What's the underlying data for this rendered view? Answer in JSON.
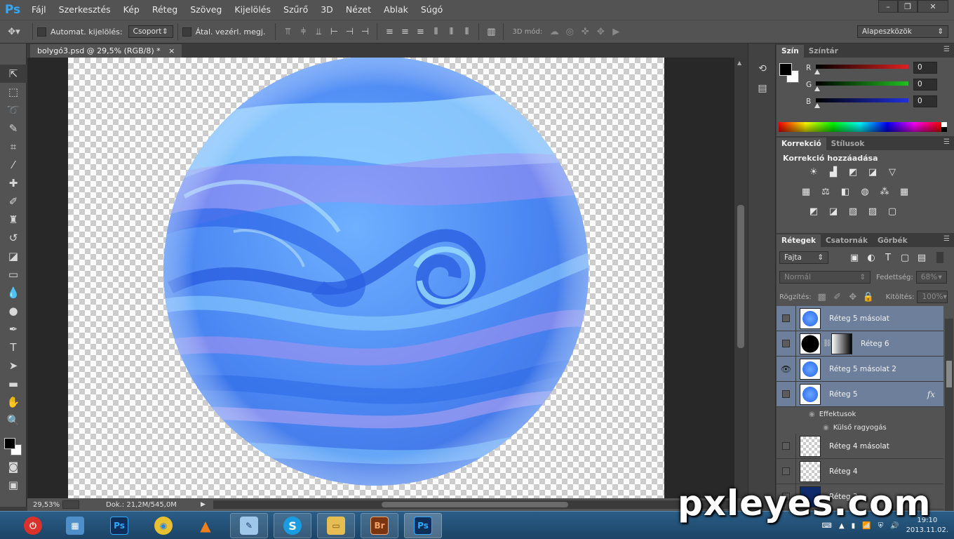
{
  "app": {
    "logo": "Ps"
  },
  "menu": [
    "Fájl",
    "Szerkesztés",
    "Kép",
    "Réteg",
    "Szöveg",
    "Kijelölés",
    "Szűrő",
    "3D",
    "Nézet",
    "Ablak",
    "Súgó"
  ],
  "window_controls": {
    "minimize": "–",
    "restore": "❐",
    "close": "✕"
  },
  "options": {
    "auto_select_label": "Automat. kijelölés:",
    "auto_select_value": "Csoport",
    "transform_label": "Átal. vezérl. megj.",
    "mode3d_label": "3D mód:",
    "workspace": "Alapeszközök"
  },
  "tools": [
    "move-icon",
    "marquee-icon",
    "lasso-icon",
    "quick-select-icon",
    "crop-icon",
    "eyedropper-icon",
    "healing-brush-icon",
    "brush-icon",
    "clone-stamp-icon",
    "history-brush-icon",
    "eraser-icon",
    "gradient-icon",
    "blur-icon",
    "dodge-icon",
    "pen-icon",
    "type-icon",
    "path-select-icon",
    "shape-icon",
    "hand-icon",
    "zoom-icon"
  ],
  "document": {
    "tab_title": "bolygó3.psd @ 29,5% (RGB/8) *",
    "tab_close": "×",
    "zoom": "29,53%",
    "doc_info": "Dok.: 21,2M/545,0M"
  },
  "color_panel": {
    "tabs": [
      "Szín",
      "Színtár"
    ],
    "active_tab": "Szín",
    "sliders": [
      {
        "label": "R",
        "value": "0",
        "color": "#e02020"
      },
      {
        "label": "G",
        "value": "0",
        "color": "#20c020"
      },
      {
        "label": "B",
        "value": "0",
        "color": "#2030e0"
      }
    ],
    "foreground": "#000000",
    "background": "#ffffff"
  },
  "corrections_panel": {
    "tabs": [
      "Korrekció",
      "Stílusok"
    ],
    "active_tab": "Korrekció",
    "title": "Korrekció hozzáadása",
    "icons_row1": [
      "brightness-icon",
      "levels-icon",
      "curves-icon",
      "exposure-icon",
      "triangle-icon"
    ],
    "icons_row2": [
      "vibrance-icon",
      "color-balance-icon",
      "black-white-icon",
      "photo-filter-icon",
      "channel-mixer-icon",
      "color-lookup-icon"
    ],
    "icons_row3": [
      "invert-icon",
      "posterize-icon",
      "threshold-icon",
      "gradient-map-icon",
      "selective-color-icon"
    ]
  },
  "layers_panel": {
    "tabs": [
      "Rétegek",
      "Csatornák",
      "Görbék"
    ],
    "active_tab": "Rétegek",
    "filter_kind": "Fajta",
    "blend_mode": "Normál",
    "opacity_label": "Fedettség:",
    "opacity_value": "68%",
    "lock_label": "Rögzítés:",
    "fill_label": "Kitöltés:",
    "fill_value": "100%",
    "layers": [
      {
        "name": "Réteg 5 másolat",
        "visible": false,
        "selected": true,
        "thumb": "planet"
      },
      {
        "name": "Réteg 6",
        "visible": false,
        "selected": true,
        "thumb": "black",
        "mask": true
      },
      {
        "name": "Réteg 5 másolat 2",
        "visible": true,
        "selected": true,
        "thumb": "planet"
      },
      {
        "name": "Réteg 5",
        "visible": false,
        "selected": true,
        "thumb": "planet",
        "fx": "fx"
      },
      {
        "name": "Réteg 4 másolat",
        "visible": false,
        "selected": false,
        "thumb": "checker"
      },
      {
        "name": "Réteg 4",
        "visible": false,
        "selected": false,
        "thumb": "checker"
      },
      {
        "name": "Réteg 3",
        "visible": false,
        "selected": false,
        "thumb": "navy"
      }
    ],
    "effects_label": "Effektusok",
    "effect_outer_glow": "Külső ragyogás"
  },
  "taskbar": {
    "apps": [
      {
        "name": "power",
        "label": "⏻",
        "color": "#d9322a"
      },
      {
        "name": "calculator",
        "label": "▦",
        "color": "#4f8fc9"
      },
      {
        "name": "photoshop",
        "label": "Ps",
        "color": "#0f2e5a"
      },
      {
        "name": "chrome",
        "label": "◉",
        "color": "#e8c030"
      },
      {
        "name": "vlc",
        "label": "▲",
        "color": "#ef7f1a"
      },
      {
        "name": "notepad",
        "label": "✎",
        "color": "#9fc7ea"
      },
      {
        "name": "skype",
        "label": "S",
        "color": "#1a9de0"
      },
      {
        "name": "explorer",
        "label": "▭",
        "color": "#e5bd52"
      },
      {
        "name": "bridge",
        "label": "Br",
        "color": "#7a3410"
      },
      {
        "name": "photoshop-open",
        "label": "Ps",
        "color": "#0f2e5a"
      }
    ],
    "time": "19:10",
    "date": "2013.11.02."
  },
  "watermark": "pxleyes.com",
  "colors": {
    "accent_ps": "#31a8ff",
    "panel_bg": "#535353",
    "selected_layer": "#6d7f9b"
  }
}
